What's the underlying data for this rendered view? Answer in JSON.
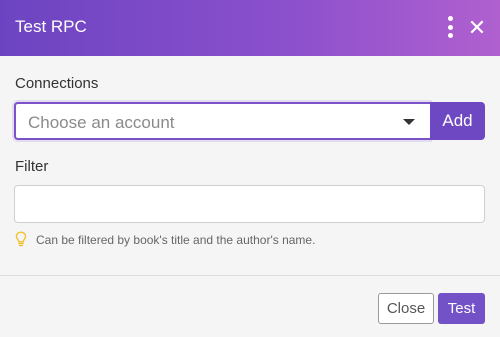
{
  "dialog": {
    "title": "Test RPC",
    "header_icons": [
      "more-vertical-icon",
      "close-icon"
    ],
    "close_glyph": "✕"
  },
  "connections": {
    "label": "Connections",
    "placeholder": "Choose an account",
    "add_label": "Add"
  },
  "filter": {
    "label": "Filter",
    "value": "",
    "hint_icon": "lightbulb-icon",
    "hint": "Can be filtered by book's title and the author's name."
  },
  "footer": {
    "close_label": "Close",
    "test_label": "Test"
  },
  "colors": {
    "accent": "#6e48c2",
    "header_gradient_start": "#6c44c1",
    "header_gradient_end": "#b060cf",
    "hint_icon": "#f2c230"
  }
}
